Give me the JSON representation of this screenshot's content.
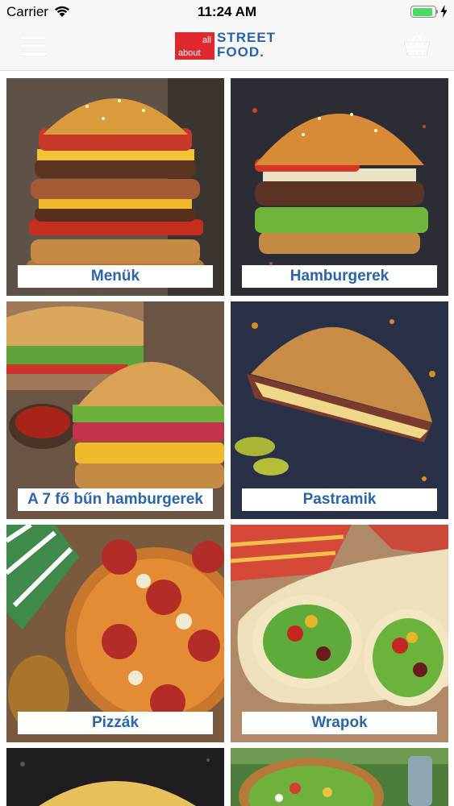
{
  "status_bar": {
    "carrier": "Carrier",
    "time": "11:24 AM",
    "battery_level": 0.95
  },
  "header": {
    "menu_icon": "hamburger-menu-icon",
    "logo": {
      "small_text_line1": "all",
      "small_text_line2": "about",
      "word1": "STREET",
      "word2": "FOOD."
    },
    "cart_icon": "shopping-basket-icon"
  },
  "categories": [
    {
      "label": "Menük"
    },
    {
      "label": "Hamburgerek"
    },
    {
      "label": "A 7 fő bűn hamburgerek"
    },
    {
      "label": "Pastramik"
    },
    {
      "label": "Pizzák"
    },
    {
      "label": "Wrapok"
    },
    {
      "label": ""
    },
    {
      "label": ""
    }
  ],
  "colors": {
    "label_text": "#2c64a8",
    "logo_red": "#e0282f",
    "logo_blue": "#2a62ab",
    "battery_green": "#4cd964"
  }
}
